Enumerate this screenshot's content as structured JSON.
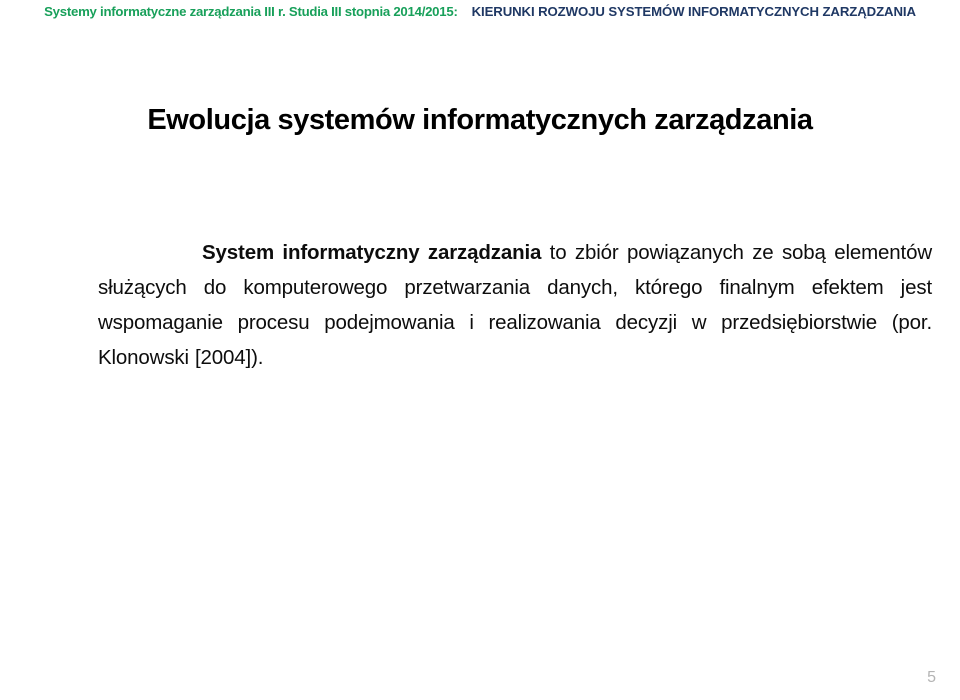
{
  "slide": {
    "header": {
      "course": "Systemy informatyczne zarządzania  III r.  Studia III stopnia 2014/2015:",
      "topic": "KIERUNKI ROZWOJU SYSTEMÓW INFORMATYCZNYCH ZARZĄDZANIA",
      "course_color": "#18A05A",
      "topic_color": "#1F3864"
    },
    "title": "Ewolucja systemów informatycznych zarządzania",
    "body": {
      "lead": "System informatyczny zarządzania",
      "rest": " to zbiór powiązanych ze sobą elementów służących do komputerowego przetwarzania danych, którego finalnym efektem jest wspomaganie procesu podejmowania i realizowania decyzji w przedsiębiorstwie (por. Klonowski [2004])."
    },
    "page_number": "5"
  }
}
